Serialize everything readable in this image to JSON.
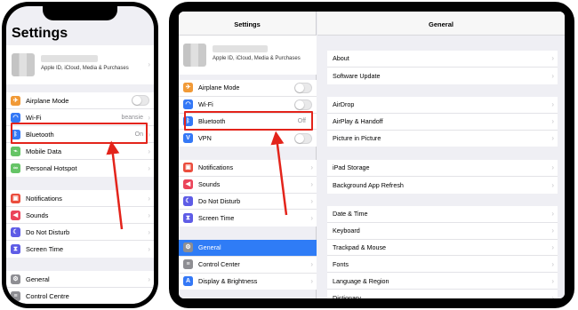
{
  "phone": {
    "title": "Settings",
    "profile": {
      "subtitle": "Apple ID, iCloud, Media & Purchases"
    },
    "group1": [
      {
        "label": "Airplane Mode",
        "icon": "airplane-icon",
        "color": "#f19a37",
        "toggle": true
      },
      {
        "label": "Wi-Fi",
        "icon": "wifi-icon",
        "color": "#3478f6",
        "value": "beansie"
      },
      {
        "label": "Bluetooth",
        "icon": "bluetooth-icon",
        "color": "#3478f6",
        "value": "On"
      },
      {
        "label": "Mobile Data",
        "icon": "antenna-icon",
        "color": "#65c466"
      },
      {
        "label": "Personal Hotspot",
        "icon": "link-icon",
        "color": "#65c466"
      }
    ],
    "group2": [
      {
        "label": "Notifications",
        "icon": "notifications-icon",
        "color": "#eb4d3d"
      },
      {
        "label": "Sounds",
        "icon": "speaker-icon",
        "color": "#eb445a"
      },
      {
        "label": "Do Not Disturb",
        "icon": "moon-icon",
        "color": "#5e5ce6"
      },
      {
        "label": "Screen Time",
        "icon": "hourglass-icon",
        "color": "#5e5ce6"
      }
    ],
    "group3": [
      {
        "label": "General",
        "icon": "gear-icon",
        "color": "#8e8e93"
      },
      {
        "label": "Control Centre",
        "icon": "switches-icon",
        "color": "#8e8e93"
      }
    ]
  },
  "tablet": {
    "master_title": "Settings",
    "detail_title": "General",
    "profile": {
      "subtitle": "Apple ID, iCloud, Media & Purchases"
    },
    "group1": [
      {
        "label": "Airplane Mode",
        "icon": "airplane-icon",
        "color": "#f19a37",
        "toggle": true
      },
      {
        "label": "Wi-Fi",
        "icon": "wifi-icon",
        "color": "#3478f6",
        "toggle": true
      },
      {
        "label": "Bluetooth",
        "icon": "bluetooth-icon",
        "color": "#3478f6",
        "value": "Off"
      },
      {
        "label": "VPN",
        "icon": "vpn-icon",
        "color": "#3478f6",
        "toggle": true
      }
    ],
    "group2": [
      {
        "label": "Notifications",
        "icon": "notifications-icon",
        "color": "#eb4d3d"
      },
      {
        "label": "Sounds",
        "icon": "speaker-icon",
        "color": "#eb445a"
      },
      {
        "label": "Do Not Disturb",
        "icon": "moon-icon",
        "color": "#5e5ce6"
      },
      {
        "label": "Screen Time",
        "icon": "hourglass-icon",
        "color": "#5e5ce6"
      }
    ],
    "group3": [
      {
        "label": "General",
        "icon": "gear-icon",
        "color": "#8e8e93",
        "selected": true
      },
      {
        "label": "Control Center",
        "icon": "switches-icon",
        "color": "#8e8e93"
      },
      {
        "label": "Display & Brightness",
        "icon": "display-icon",
        "color": "#3478f6"
      }
    ],
    "detail_groups": [
      [
        "About",
        "Software Update"
      ],
      [
        "AirDrop",
        "AirPlay & Handoff",
        "Picture in Picture"
      ],
      [
        "iPad Storage",
        "Background App Refresh"
      ],
      [
        "Date & Time",
        "Keyboard",
        "Trackpad & Mouse",
        "Fonts",
        "Language & Region",
        "Dictionary"
      ]
    ]
  },
  "colors": {
    "highlight": "#e3241b",
    "accent": "#2f7cf6"
  }
}
